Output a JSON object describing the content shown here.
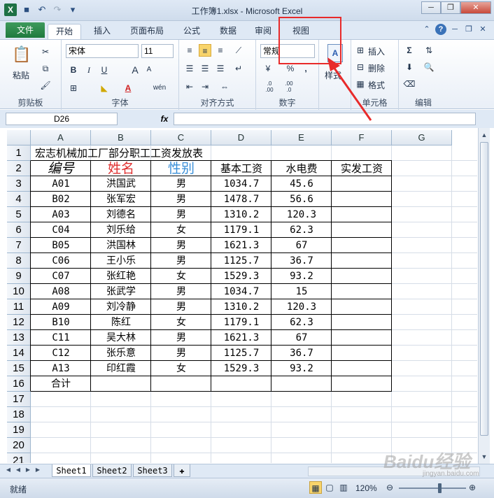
{
  "app": {
    "title": "工作簿1.xlsx - Microsoft Excel",
    "logo": "X"
  },
  "tabs": {
    "file": "文件",
    "items": [
      "开始",
      "插入",
      "页面布局",
      "公式",
      "数据",
      "审阅",
      "视图"
    ],
    "active": "开始"
  },
  "ribbon": {
    "clipboard": {
      "label": "剪贴板",
      "paste": "粘贴"
    },
    "font": {
      "label": "字体",
      "name": "宋体",
      "size": "11",
      "bold": "B",
      "italic": "I",
      "underline": "U",
      "grow": "A",
      "shrink": "A",
      "phonetic": "wén"
    },
    "alignment": {
      "label": "对齐方式"
    },
    "number": {
      "label": "数字",
      "format": "常规",
      "percent": "%",
      "comma": ",",
      "inc_decimal": ".0\n.00",
      "dec_decimal": ".00\n.0"
    },
    "styles": {
      "label": "样式"
    },
    "cells": {
      "label": "单元格",
      "insert": "插入",
      "delete": "删除",
      "format": "格式"
    },
    "editing": {
      "label": "编辑",
      "sum": "Σ"
    }
  },
  "formula_bar": {
    "cell_ref": "D26",
    "fx": "fx",
    "formula": ""
  },
  "columns": [
    "A",
    "B",
    "C",
    "D",
    "E",
    "F",
    "G"
  ],
  "rows": [
    "1",
    "2",
    "3",
    "4",
    "5",
    "6",
    "7",
    "8",
    "9",
    "10",
    "11",
    "12",
    "13",
    "14",
    "15",
    "16",
    "17",
    "18",
    "19",
    "20",
    "21"
  ],
  "sheet": {
    "title": "宏志机械加工厂部分职工工资发放表",
    "headers": [
      "编号",
      "姓名",
      "性别",
      "基本工资",
      "水电费",
      "实发工资"
    ],
    "header_colors": [
      "#000000",
      "#e03030",
      "#3a8fd8",
      "#000000",
      "#000000",
      "#000000"
    ],
    "data": [
      [
        "A01",
        "洪国武",
        "男",
        "1034.7",
        "45.6"
      ],
      [
        "B02",
        "张军宏",
        "男",
        "1478.7",
        "56.6"
      ],
      [
        "A03",
        "刘德名",
        "男",
        "1310.2",
        "120.3"
      ],
      [
        "C04",
        "刘乐给",
        "女",
        "1179.1",
        "62.3"
      ],
      [
        "B05",
        "洪国林",
        "男",
        "1621.3",
        "67"
      ],
      [
        "C06",
        "王小乐",
        "男",
        "1125.7",
        "36.7"
      ],
      [
        "C07",
        "张红艳",
        "女",
        "1529.3",
        "93.2"
      ],
      [
        "A08",
        "张武学",
        "男",
        "1034.7",
        "15"
      ],
      [
        "A09",
        "刘冷静",
        "男",
        "1310.2",
        "120.3"
      ],
      [
        "B10",
        "陈红",
        "女",
        "1179.1",
        "62.3"
      ],
      [
        "C11",
        "吴大林",
        "男",
        "1621.3",
        "67"
      ],
      [
        "C12",
        "张乐意",
        "男",
        "1125.7",
        "36.7"
      ],
      [
        "A13",
        "印红霞",
        "女",
        "1529.3",
        "93.2"
      ]
    ],
    "total_label": "合计"
  },
  "sheet_tabs": [
    "Sheet1",
    "Sheet2",
    "Sheet3"
  ],
  "status": {
    "ready": "就绪",
    "zoom": "120%"
  },
  "watermark": {
    "main": "Baidu经验",
    "sub": "jingyan.baidu.com"
  }
}
